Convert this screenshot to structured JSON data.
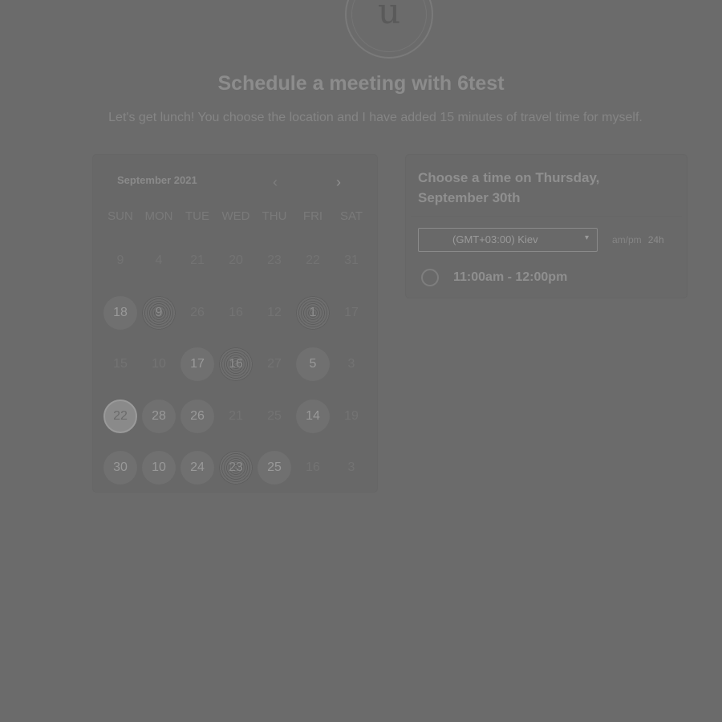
{
  "logo": {
    "letter": "u"
  },
  "header": {
    "title": "Schedule a meeting with 6test",
    "subtitle": "Let's get lunch! You choose the location and I have added 15 minutes of travel time for myself."
  },
  "calendar": {
    "month_label": "September 2021",
    "prev_icon": "‹",
    "next_icon": "›",
    "weekdays": [
      "SUN",
      "MON",
      "TUE",
      "WED",
      "THU",
      "FRI",
      "SAT"
    ],
    "weeks": [
      [
        {
          "n": "9",
          "s": "off"
        },
        {
          "n": "4",
          "s": "off"
        },
        {
          "n": "21",
          "s": "off"
        },
        {
          "n": "20",
          "s": "off"
        },
        {
          "n": "23",
          "s": "off"
        },
        {
          "n": "22",
          "s": "off"
        },
        {
          "n": "31",
          "s": "off"
        }
      ],
      [
        {
          "n": "18",
          "s": "avail"
        },
        {
          "n": "9",
          "s": "busy"
        },
        {
          "n": "26",
          "s": "off"
        },
        {
          "n": "16",
          "s": "off"
        },
        {
          "n": "12",
          "s": "off"
        },
        {
          "n": "1",
          "s": "busy"
        },
        {
          "n": "17",
          "s": "off"
        }
      ],
      [
        {
          "n": "15",
          "s": "off"
        },
        {
          "n": "10",
          "s": "off"
        },
        {
          "n": "17",
          "s": "avail"
        },
        {
          "n": "16",
          "s": "busy"
        },
        {
          "n": "27",
          "s": "off"
        },
        {
          "n": "5",
          "s": "avail"
        },
        {
          "n": "3",
          "s": "off"
        }
      ],
      [
        {
          "n": "22",
          "s": "selected"
        },
        {
          "n": "28",
          "s": "avail"
        },
        {
          "n": "26",
          "s": "avail"
        },
        {
          "n": "21",
          "s": "off"
        },
        {
          "n": "25",
          "s": "off"
        },
        {
          "n": "14",
          "s": "avail"
        },
        {
          "n": "19",
          "s": "off"
        }
      ],
      [
        {
          "n": "30",
          "s": "avail"
        },
        {
          "n": "10",
          "s": "avail"
        },
        {
          "n": "24",
          "s": "avail"
        },
        {
          "n": "23",
          "s": "busy"
        },
        {
          "n": "25",
          "s": "avail"
        },
        {
          "n": "16",
          "s": "off"
        },
        {
          "n": "3",
          "s": "off"
        }
      ]
    ]
  },
  "time_panel": {
    "heading": "Choose a time on Thursday, September 30th",
    "timezone": "(GMT+03:00) Kiev",
    "caret_icon": "▾",
    "format_ampm": "am/pm",
    "format_24h": "24h",
    "slots": [
      {
        "label": "11:00am - 12:00pm"
      }
    ]
  }
}
